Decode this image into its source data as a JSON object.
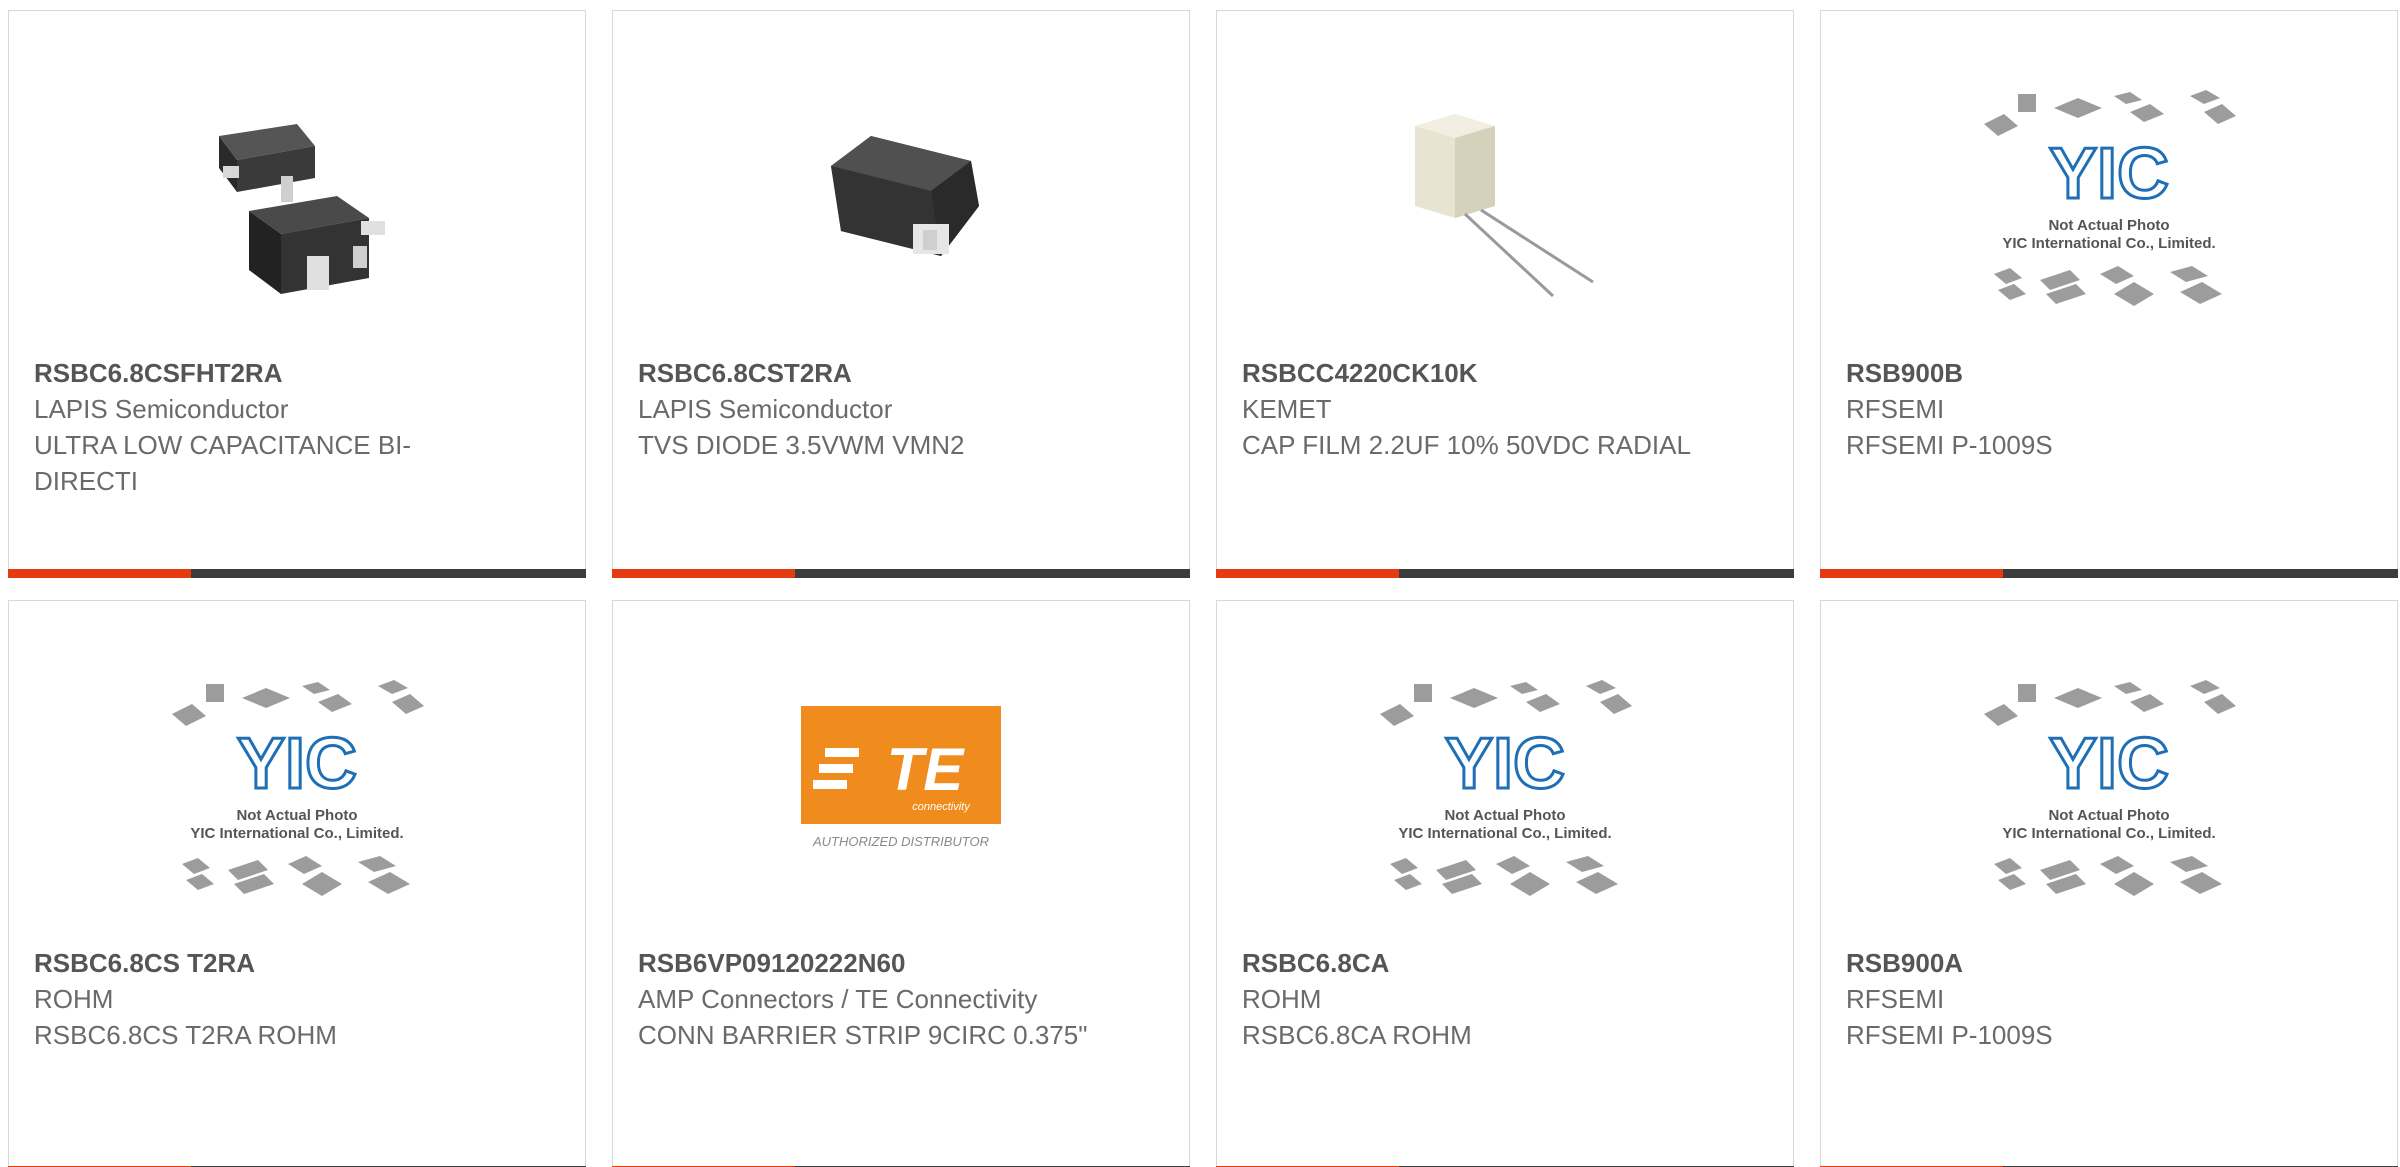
{
  "colors": {
    "accent": "#e63a10",
    "bar_dark": "#3c3c3c",
    "title_text": "#555555",
    "body_text": "#6a6a6a",
    "te_orange": "#f08c1e"
  },
  "placeholder": {
    "logo_text": "YIC",
    "line1": "Not Actual Photo",
    "line2": "YIC International Co., Limited."
  },
  "te_logo": {
    "brand": "TE",
    "sub": "connectivity",
    "caption": "AUTHORIZED DISTRIBUTOR"
  },
  "products": [
    {
      "part_number": "RSBC6.8CSFHT2RA",
      "manufacturer": "LAPIS Semiconductor",
      "description": "ULTRA LOW CAPACITANCE BI-DIRECTI",
      "image": "sot-package-photo"
    },
    {
      "part_number": "RSBC6.8CST2RA",
      "manufacturer": "LAPIS Semiconductor",
      "description": "TVS DIODE 3.5VWM VMN2",
      "image": "smd-diode-photo"
    },
    {
      "part_number": "RSBCC4220CK10K",
      "manufacturer": "KEMET",
      "description": "CAP FILM 2.2UF 10% 50VDC RADIAL",
      "image": "film-capacitor-photo"
    },
    {
      "part_number": "RSB900B",
      "manufacturer": "RFSEMI",
      "description": "RFSEMI P-1009S",
      "image": "yic-placeholder"
    },
    {
      "part_number": "RSBC6.8CS T2RA",
      "manufacturer": "ROHM",
      "description": "RSBC6.8CS T2RA ROHM",
      "image": "yic-placeholder"
    },
    {
      "part_number": "RSB6VP09120222N60",
      "manufacturer": "AMP Connectors / TE Connectivity",
      "description": "CONN BARRIER STRIP 9CIRC 0.375\"",
      "image": "te-connectivity-logo"
    },
    {
      "part_number": "RSBC6.8CA",
      "manufacturer": "ROHM",
      "description": "RSBC6.8CA ROHM",
      "image": "yic-placeholder"
    },
    {
      "part_number": "RSB900A",
      "manufacturer": "RFSEMI",
      "description": "RFSEMI P-1009S",
      "image": "yic-placeholder"
    }
  ]
}
